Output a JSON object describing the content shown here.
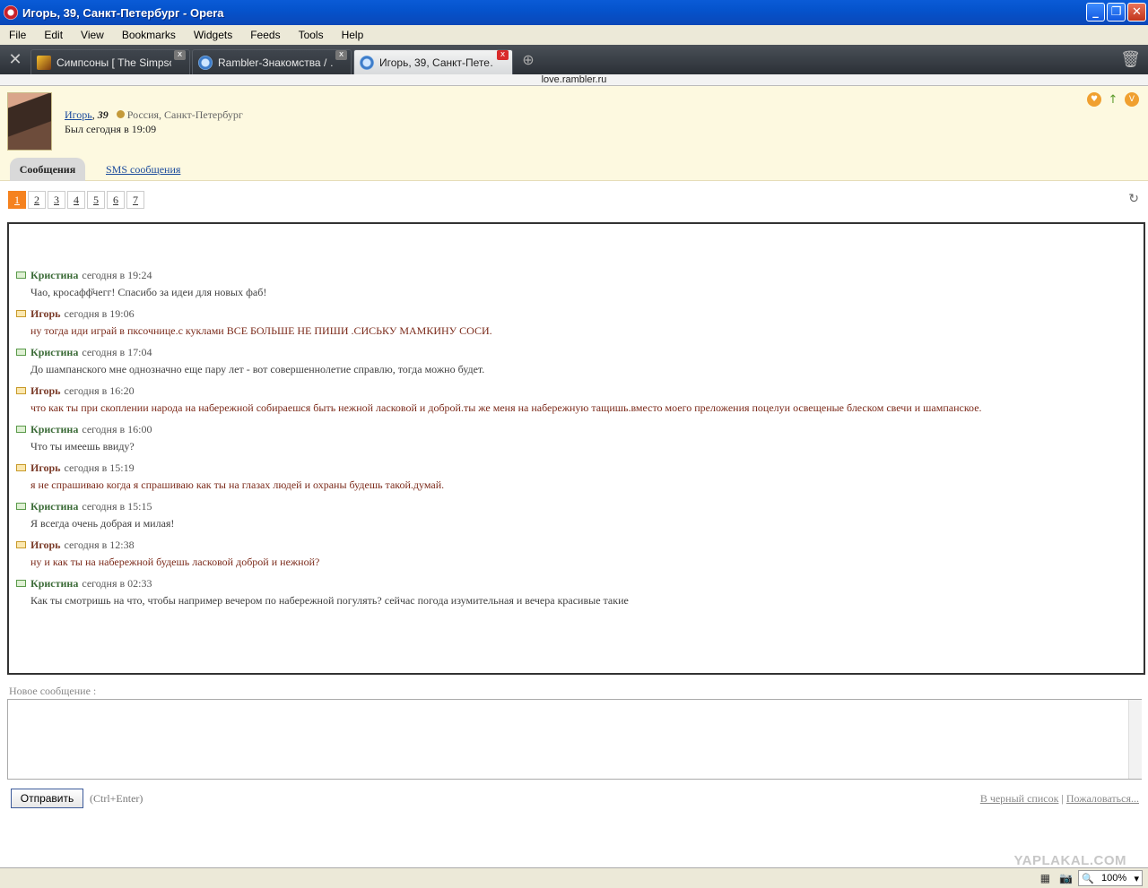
{
  "window": {
    "title": "Игорь, 39, Санкт-Петербург - Opera"
  },
  "menu": [
    "File",
    "Edit",
    "View",
    "Bookmarks",
    "Widgets",
    "Feeds",
    "Tools",
    "Help"
  ],
  "tabs": [
    {
      "label": "Симпсоны [ The Simpso…",
      "active": false
    },
    {
      "label": "Rambler-Знакомства / …",
      "active": false
    },
    {
      "label": "Игорь, 39, Санкт-Пете…",
      "active": true
    }
  ],
  "address": "love.rambler.ru",
  "profile": {
    "name": "Игорь",
    "sep": ",",
    "age": "39",
    "location": "Россия, Санкт-Петербург",
    "last_seen": "Был сегодня в 19:09"
  },
  "page_tabs": {
    "messages": "Сообщения",
    "sms": "SMS сообщения"
  },
  "pages": [
    "1",
    "2",
    "3",
    "4",
    "5",
    "6",
    "7"
  ],
  "messages": [
    {
      "dir": "in",
      "author": "Кристина",
      "time": "сегодня в 19:24",
      "text": "Чао, кросафф̆чегг! Спасибо за идеи для новых фаб!"
    },
    {
      "dir": "out",
      "author": "Игорь",
      "time": "сегодня в 19:06",
      "text": "ну тогда иди играй в пксочнице.с куклами ВСЕ БОЛЬШЕ НЕ ПИШИ .СИСЬКУ МАМКИНУ СОСИ."
    },
    {
      "dir": "in",
      "author": "Кристина",
      "time": "сегодня в 17:04",
      "text": "До шампанского мне однозначно еще пару лет - вот совершеннолетие справлю, тогда можно будет."
    },
    {
      "dir": "out",
      "author": "Игорь",
      "time": "сегодня в 16:20",
      "text": "что как ты при скоплении народа на набережной собираешся быть нежной ласковой и доброй.ты же меня на набережную тащишь.вместо моего прeложения поцелуи освещеные блеском свечи и шампанское."
    },
    {
      "dir": "in",
      "author": "Кристина",
      "time": "сегодня в 16:00",
      "text": "Что ты имеешь ввиду?"
    },
    {
      "dir": "out",
      "author": "Игорь",
      "time": "сегодня в 15:19",
      "text": "я не спрашиваю когда я спрашиваю как ты на глазах людей и охраны будешь такой.думай."
    },
    {
      "dir": "in",
      "author": "Кристина",
      "time": "сегодня в 15:15",
      "text": "Я всегда очень добрая и милая!"
    },
    {
      "dir": "out",
      "author": "Игорь",
      "time": "сегодня в 12:38",
      "text": "ну и как ты на набережной будешь ласковой доброй и нежной?"
    },
    {
      "dir": "in",
      "author": "Кристина",
      "time": "сегодня в 02:33",
      "text": "Как ты смотришь на что, чтобы например вечером по набережной погулять? сейчас погода изумительная и вечера красивые такие"
    }
  ],
  "compose": {
    "label": "Новое сообщение :",
    "value": "",
    "send": "Отправить",
    "hint": "(Ctrl+Enter)",
    "blacklist": "В черный список",
    "divider": "|",
    "complain": "Пожаловаться..."
  },
  "watermark": "YAPLAKAL.COM",
  "status": {
    "zoom": "100%"
  },
  "icons": {
    "window": "opera-icon",
    "tools": "wrench-icon",
    "newtab": "plus-icon",
    "trash": "trash-icon",
    "refresh": "refresh-icon",
    "incoming": "envelope-green-icon",
    "outgoing": "envelope-yellow-icon"
  }
}
